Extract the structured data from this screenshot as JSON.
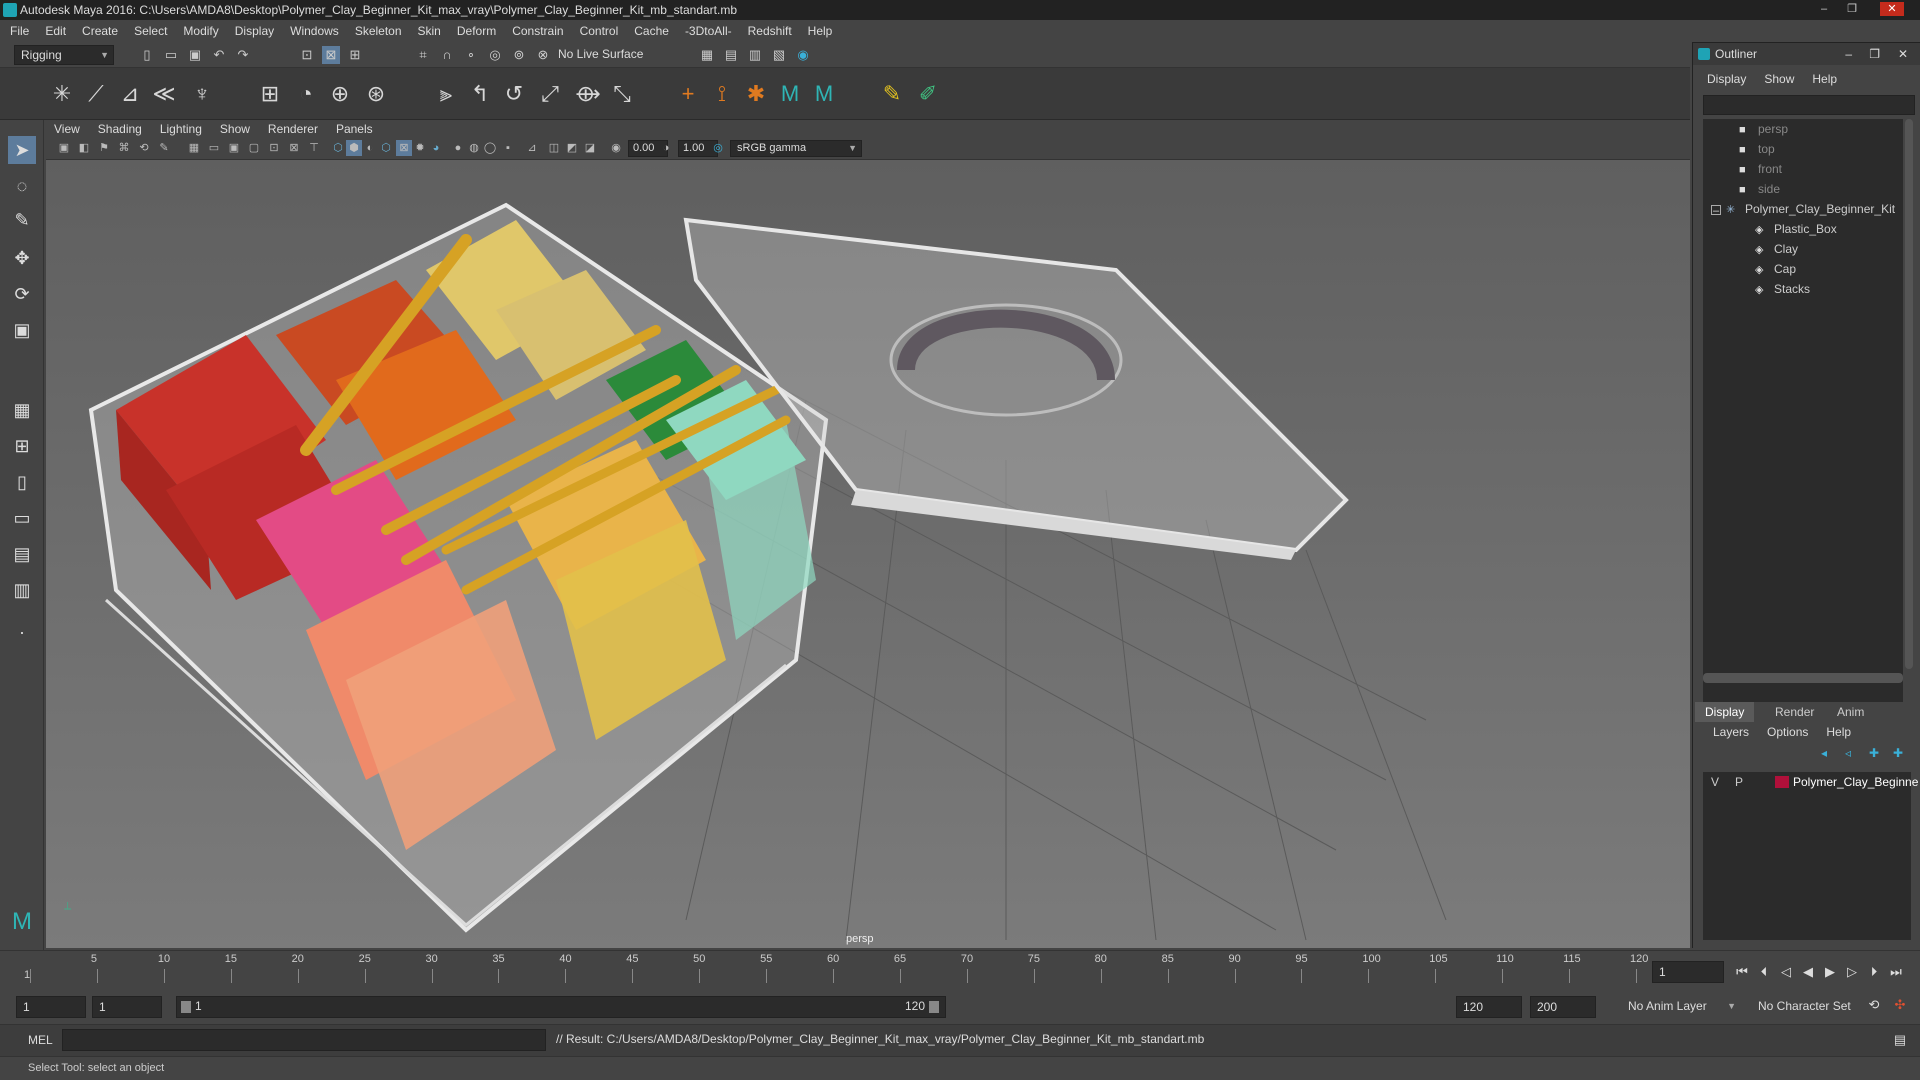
{
  "window": {
    "title": "Autodesk Maya 2016: C:\\Users\\AMDA8\\Desktop\\Polymer_Clay_Beginner_Kit_max_vray\\Polymer_Clay_Beginner_Kit_mb_standart.mb",
    "controls": [
      "–",
      "❐",
      "✕"
    ]
  },
  "menubar": [
    "File",
    "Edit",
    "Create",
    "Select",
    "Modify",
    "Display",
    "Windows",
    "Skeleton",
    "Skin",
    "Deform",
    "Constrain",
    "Control",
    "Cache",
    "-3DtoAll-",
    "Redshift",
    "Help"
  ],
  "statusline": {
    "menuset": "Rigging",
    "live_surface": "No Live Surface"
  },
  "viewport": {
    "menu": [
      "View",
      "Shading",
      "Lighting",
      "Show",
      "Renderer",
      "Panels"
    ],
    "exposure": "0.00",
    "gamma": "1.00",
    "color_space": "sRGB gamma",
    "camera_label": "persp"
  },
  "outliner": {
    "title": "Outliner",
    "menu": [
      "Display",
      "Show",
      "Help"
    ],
    "cameras": [
      "persp",
      "top",
      "front",
      "side"
    ],
    "root": "Polymer_Clay_Beginner_Kit",
    "children": [
      "Plastic_Box",
      "Clay",
      "Cap",
      "Stacks"
    ]
  },
  "layers": {
    "tabs": [
      "Display",
      "Render",
      "Anim"
    ],
    "menu": [
      "Layers",
      "Options",
      "Help"
    ],
    "layer": {
      "v": "V",
      "p": "P",
      "name": "Polymer_Clay_Beginne",
      "color": "#b0103a"
    }
  },
  "timeline": {
    "ticks": [
      "1",
      "5",
      "10",
      "15",
      "20",
      "25",
      "30",
      "35",
      "40",
      "45",
      "50",
      "55",
      "60",
      "65",
      "70",
      "75",
      "80",
      "85",
      "90",
      "95",
      "100",
      "105",
      "110",
      "115",
      "120"
    ],
    "current_frame": "1"
  },
  "range": {
    "start": "1",
    "playback_start": "1",
    "slider_start": "1",
    "slider_end": "120",
    "playback_end": "120",
    "end": "200",
    "anim_layer": "No Anim Layer",
    "character_set": "No Character Set"
  },
  "cmdline": {
    "lang": "MEL",
    "result": "// Result: C:/Users/AMDA8/Desktop/Polymer_Clay_Beginner_Kit_max_vray/Polymer_Clay_Beginner_Kit_mb_standart.mb"
  },
  "helpline": {
    "text": "Select Tool: select an object"
  }
}
